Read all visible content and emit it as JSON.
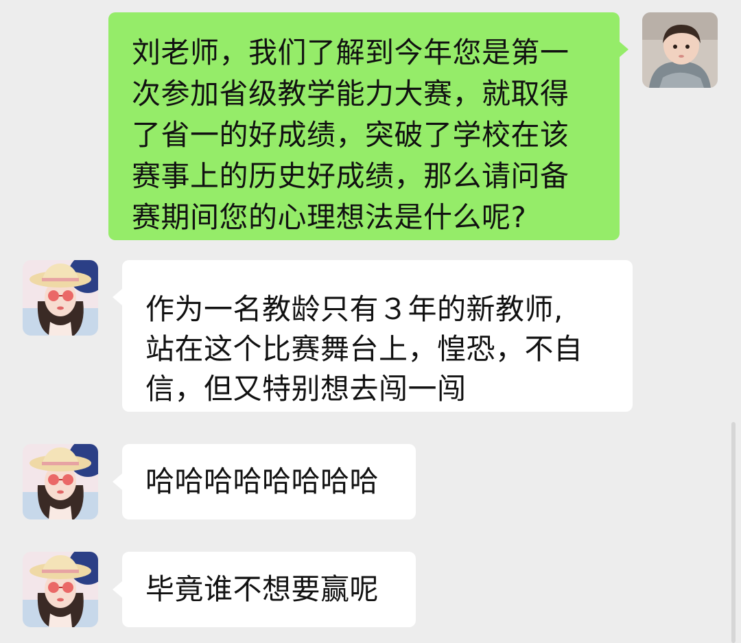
{
  "messages": [
    {
      "sender": "self",
      "lines": [
        "刘老师，我们了解到今年您是第一",
        "次参加省级教学能力大赛，就取得",
        "了省一的好成绩，突破了学校在该",
        "赛事上的历史好成绩，那么请问备",
        "赛期间您的心理想法是什么呢?"
      ]
    },
    {
      "sender": "other",
      "lines": [
        "作为一名教龄只有３年的新教师,",
        "站在这个比赛舞台上，惶恐，不自",
        "信，但又特别想去闯一闯"
      ]
    },
    {
      "sender": "other",
      "lines": [
        "哈哈哈哈哈哈哈哈"
      ]
    },
    {
      "sender": "other",
      "lines": [
        "毕竟谁不想要赢呢"
      ]
    }
  ],
  "colors": {
    "background": "#ededed",
    "sent_bubble": "#95ec69",
    "received_bubble": "#ffffff",
    "text": "#111111"
  },
  "avatars": {
    "self": "child-avatar-photo",
    "other": "woman-sunhat-avatar-photo"
  }
}
